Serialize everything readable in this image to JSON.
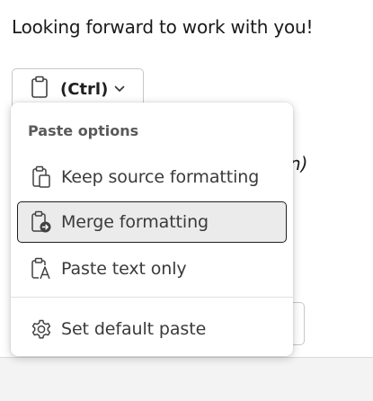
{
  "document": {
    "line1": "Looking forward to work with you!",
    "obscured_fragment": "n)"
  },
  "paste_button": {
    "label": "(Ctrl)",
    "icon": "clipboard-icon",
    "dropdown_icon": "chevron-down-icon"
  },
  "paste_menu": {
    "header": "Paste options",
    "items": [
      {
        "label": "Keep source formatting",
        "icon": "clipboard-keep-source-icon",
        "selected": false
      },
      {
        "label": "Merge formatting",
        "icon": "clipboard-merge-icon",
        "selected": true
      },
      {
        "label": "Paste text only",
        "icon": "clipboard-text-only-icon",
        "selected": false
      }
    ],
    "footer_item": {
      "label": "Set default paste",
      "icon": "gear-icon"
    }
  },
  "colors": {
    "selected_background": "#ebebeb",
    "selected_border": "#1f1f1f",
    "header_text": "#5a5a5a"
  }
}
